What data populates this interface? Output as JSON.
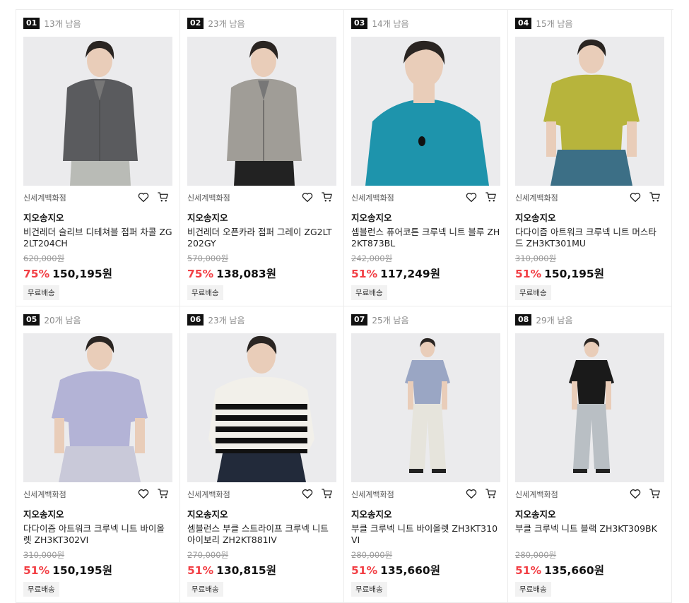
{
  "products": [
    {
      "rank": "01",
      "stock": "13개 남음",
      "store": "신세계백화점",
      "brand": "지오송지오",
      "name": "비건레더 슬리브 디테쳐블 점퍼 차콜 ZG2LT204CH",
      "original_price": "620,000원",
      "discount": "75%",
      "price": "150,195원",
      "badge": "무료배송",
      "top_color": "#5a5b5e",
      "bottom_color": "#b9bbb6",
      "style": "jacket"
    },
    {
      "rank": "02",
      "stock": "23개 남음",
      "store": "신세계백화점",
      "brand": "지오송지오",
      "name": "비건레더 오픈카라 점퍼 그레이 ZG2LT202GY",
      "original_price": "570,000원",
      "discount": "75%",
      "price": "138,083원",
      "badge": "무료배송",
      "top_color": "#a09d97",
      "bottom_color": "#222222",
      "style": "jacket"
    },
    {
      "rank": "03",
      "stock": "14개 남음",
      "store": "신세계백화점",
      "brand": "지오송지오",
      "name": "셈블런스 퓨어코튼 크루넥 니트 블루 ZH2KT873BL",
      "original_price": "242,000원",
      "discount": "51%",
      "price": "117,249원",
      "badge": "무료배송",
      "top_color": "#1e94ac",
      "bottom_color": "#1e94ac",
      "style": "closeup"
    },
    {
      "rank": "04",
      "stock": "15개 남음",
      "store": "신세계백화점",
      "brand": "지오송지오",
      "name": "다다이즘 아트워크 크루넥 니트 머스타드 ZH3KT301MU",
      "original_price": "310,000원",
      "discount": "51%",
      "price": "150,195원",
      "badge": "무료배송",
      "top_color": "#b7b43c",
      "bottom_color": "#3c6f86",
      "style": "tee"
    },
    {
      "rank": "05",
      "stock": "20개 남음",
      "store": "신세계백화점",
      "brand": "지오송지오",
      "name": "다다이즘 아트워크 크루넥 니트 바이올렛 ZH3KT302VI",
      "original_price": "310,000원",
      "discount": "51%",
      "price": "150,195원",
      "badge": "무료배송",
      "top_color": "#b3b3d6",
      "bottom_color": "#c9c9d9",
      "style": "tee"
    },
    {
      "rank": "06",
      "stock": "23개 남음",
      "store": "신세계백화점",
      "brand": "지오송지오",
      "name": "셈블런스 부클 스트라이프 크루넥 니트 아이보리 ZH2KT881IV",
      "original_price": "270,000원",
      "discount": "51%",
      "price": "130,815원",
      "badge": "무료배송",
      "top_color": "#f2f0ea",
      "bottom_color": "#222a3a",
      "style": "stripe"
    },
    {
      "rank": "07",
      "stock": "25개 남음",
      "store": "신세계백화점",
      "brand": "지오송지오",
      "name": "부클 크루넥 니트 바이올렛 ZH3KT310VI",
      "original_price": "280,000원",
      "discount": "51%",
      "price": "135,660원",
      "badge": "무료배송",
      "top_color": "#9aa6c4",
      "bottom_color": "#e6e4dc",
      "style": "full"
    },
    {
      "rank": "08",
      "stock": "29개 남음",
      "store": "신세계백화점",
      "brand": "지오송지오",
      "name": "부클 크루넥 니트 블랙 ZH3KT309BK",
      "original_price": "280,000원",
      "discount": "51%",
      "price": "135,660원",
      "badge": "무료배송",
      "top_color": "#1a1a1a",
      "bottom_color": "#b9bfc4",
      "style": "full"
    }
  ]
}
